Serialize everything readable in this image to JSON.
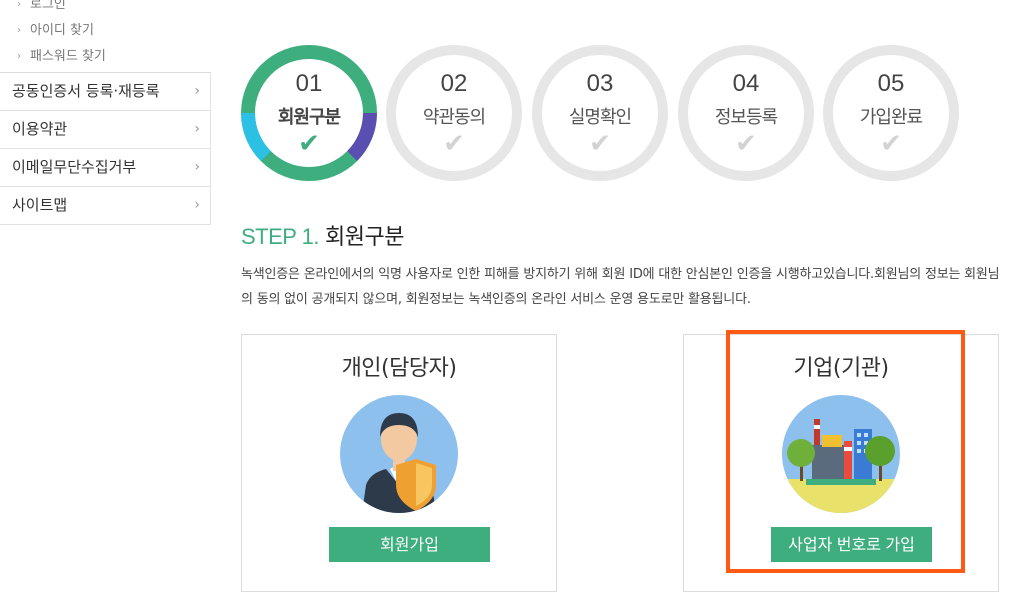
{
  "sidebar": {
    "sub_items": [
      "로그인",
      "아이디 찾기",
      "패스워드 찾기"
    ],
    "menu_items": [
      "공동인증서 등록·재등록",
      "이용약관",
      "이메일무단수집거부",
      "사이트맵"
    ]
  },
  "steps": [
    {
      "num": "01",
      "label": "회원구분",
      "active": true
    },
    {
      "num": "02",
      "label": "약관동의",
      "active": false
    },
    {
      "num": "03",
      "label": "실명확인",
      "active": false
    },
    {
      "num": "04",
      "label": "정보등록",
      "active": false
    },
    {
      "num": "05",
      "label": "가입완료",
      "active": false
    }
  ],
  "title": {
    "prefix": "STEP 1.",
    "text": "회원구분"
  },
  "description": "녹색인증은 온라인에서의 익명 사용자로 인한 피해를 방지하기 위해 회원 ID에 대한 안심본인 인증을 시행하고있습니다.회원님의 정보는 회원님의 동의 없이 공개되지 않으며, 회원정보는 녹색인증의 온라인 서비스 운영 용도로만 활용됩니다.",
  "cards": [
    {
      "title": "개인(담당자)",
      "button": "회원가입",
      "icon": "person-shield-icon"
    },
    {
      "title": "기업(기관)",
      "button": "사업자 번호로 가입",
      "icon": "factory-building-icon"
    }
  ],
  "colors": {
    "accent": "#3fae7f",
    "ring_blue": "#5a4fb0",
    "ring_cyan": "#2bc0e4",
    "highlight": "#ff5a14"
  }
}
